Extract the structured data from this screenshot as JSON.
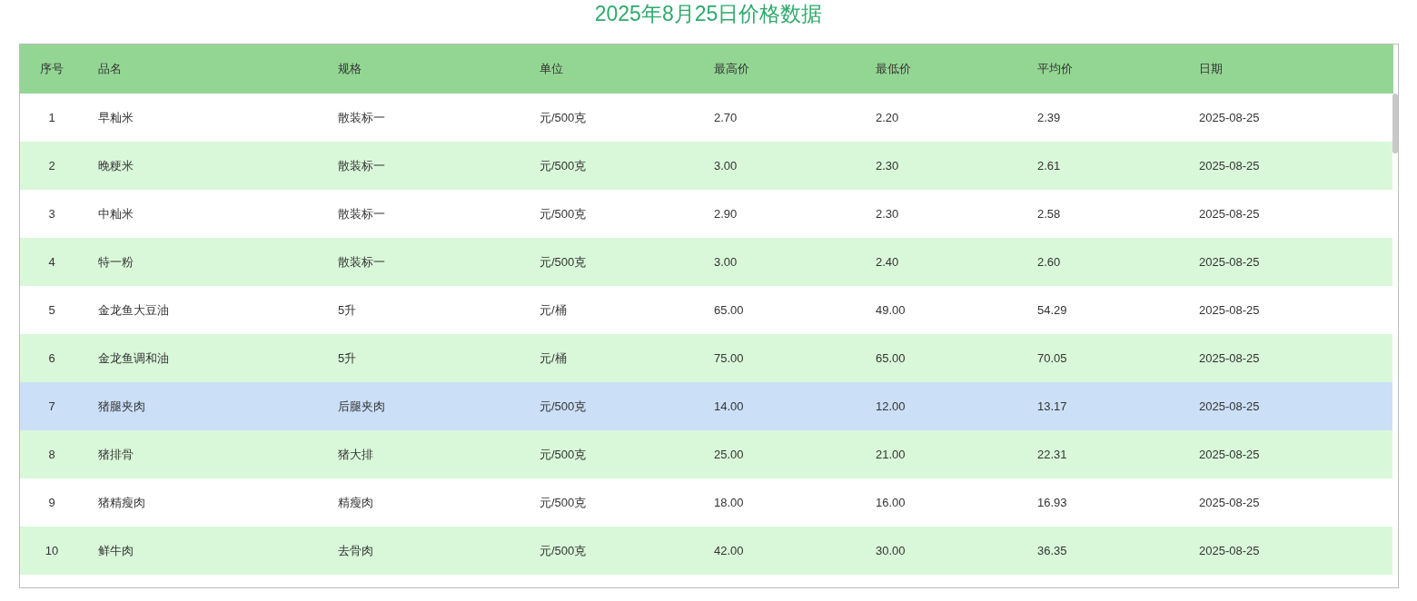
{
  "title": "2025年8月25日价格数据",
  "table": {
    "columns": [
      "序号",
      "品名",
      "规格",
      "单位",
      "最高价",
      "最低价",
      "平均价",
      "日期"
    ],
    "rows": [
      {
        "cells": [
          "1",
          "早籼米",
          "散装标一",
          "元/500克",
          "2.70",
          "2.20",
          "2.39",
          "2025-08-25"
        ],
        "selected": false
      },
      {
        "cells": [
          "2",
          "晚粳米",
          "散装标一",
          "元/500克",
          "3.00",
          "2.30",
          "2.61",
          "2025-08-25"
        ],
        "selected": false
      },
      {
        "cells": [
          "3",
          "中籼米",
          "散装标一",
          "元/500克",
          "2.90",
          "2.30",
          "2.58",
          "2025-08-25"
        ],
        "selected": false
      },
      {
        "cells": [
          "4",
          "特一粉",
          "散装标一",
          "元/500克",
          "3.00",
          "2.40",
          "2.60",
          "2025-08-25"
        ],
        "selected": false
      },
      {
        "cells": [
          "5",
          "金龙鱼大豆油",
          "5升",
          "元/桶",
          "65.00",
          "49.00",
          "54.29",
          "2025-08-25"
        ],
        "selected": false
      },
      {
        "cells": [
          "6",
          "金龙鱼调和油",
          "5升",
          "元/桶",
          "75.00",
          "65.00",
          "70.05",
          "2025-08-25"
        ],
        "selected": false
      },
      {
        "cells": [
          "7",
          "猪腿夹肉",
          "后腿夹肉",
          "元/500克",
          "14.00",
          "12.00",
          "13.17",
          "2025-08-25"
        ],
        "selected": true
      },
      {
        "cells": [
          "8",
          "猪排骨",
          "猪大排",
          "元/500克",
          "25.00",
          "21.00",
          "22.31",
          "2025-08-25"
        ],
        "selected": false
      },
      {
        "cells": [
          "9",
          "猪精瘦肉",
          "精瘦肉",
          "元/500克",
          "18.00",
          "16.00",
          "16.93",
          "2025-08-25"
        ],
        "selected": false
      },
      {
        "cells": [
          "10",
          "鲜牛肉",
          "去骨肉",
          "元/500克",
          "42.00",
          "30.00",
          "36.35",
          "2025-08-25"
        ],
        "selected": false
      }
    ]
  }
}
